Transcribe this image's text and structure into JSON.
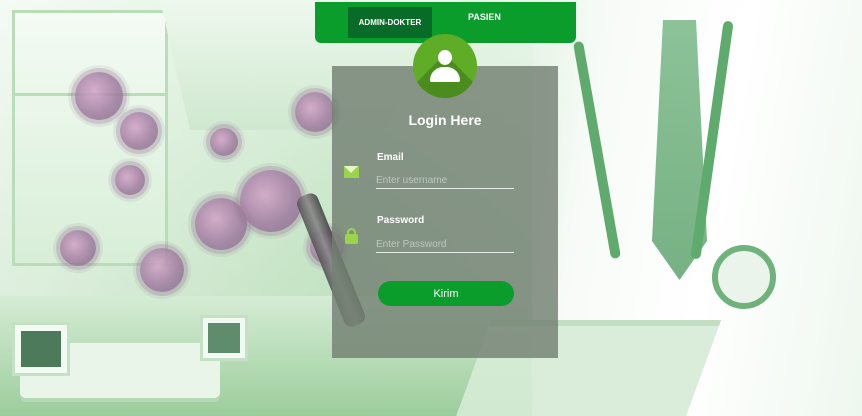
{
  "tabs": [
    {
      "label": "ADMIN-DOKTER",
      "active": true
    },
    {
      "label": "PASIEN",
      "active": false
    }
  ],
  "card": {
    "title": "Login Here",
    "email_label": "Email",
    "email_placeholder": "Enter username",
    "password_label": "Password",
    "password_placeholder": "Enter Password",
    "submit_label": "Kirim"
  },
  "icons": {
    "avatar": "user-icon",
    "email": "mail-icon",
    "password": "lock-icon"
  },
  "colors": {
    "primary_green": "#0b9d2c",
    "active_tab": "#086b27",
    "avatar_green": "#5fad26",
    "icon_green": "#9bd34d",
    "card_overlay": "#738073"
  }
}
